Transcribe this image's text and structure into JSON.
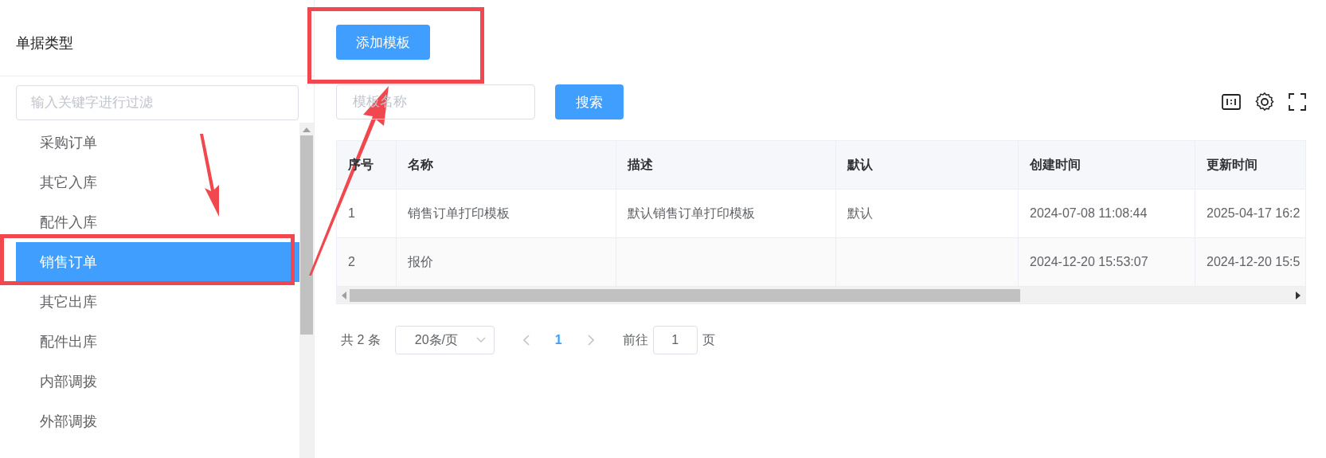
{
  "sidebar": {
    "title": "单据类型",
    "filter": {
      "placeholder": "输入关键字进行过滤"
    },
    "items": [
      {
        "label": "采购订单",
        "selected": false
      },
      {
        "label": "其它入库",
        "selected": false
      },
      {
        "label": "配件入库",
        "selected": false
      },
      {
        "label": "销售订单",
        "selected": true
      },
      {
        "label": "其它出库",
        "selected": false
      },
      {
        "label": "配件出库",
        "selected": false
      },
      {
        "label": "内部调拨",
        "selected": false
      },
      {
        "label": "外部调拨",
        "selected": false
      }
    ]
  },
  "toolbar": {
    "add_button": "添加模板",
    "search": {
      "placeholder": "模板名称"
    },
    "search_button": "搜索"
  },
  "table": {
    "columns": [
      "序号",
      "名称",
      "描述",
      "默认",
      "创建时间",
      "更新时间"
    ],
    "rows": [
      [
        "1",
        "销售订单打印模板",
        "默认销售订单打印模板",
        "默认",
        "2024-07-08 11:08:44",
        "2025-04-17 16:2"
      ],
      [
        "2",
        "报价",
        "",
        "",
        "2024-12-20 15:53:07",
        "2024-12-20 15:5"
      ]
    ]
  },
  "pagination": {
    "total": "共 2 条",
    "page_size": "20条/页",
    "pages": [
      {
        "label": "1",
        "selected": true
      }
    ],
    "goto_label": "前往",
    "goto_value": "1",
    "goto_suffix": "页"
  },
  "annotations": [
    {
      "kind": "box"
    },
    {
      "kind": "box"
    },
    {
      "kind": "arrow"
    },
    {
      "kind": "arrow"
    }
  ]
}
